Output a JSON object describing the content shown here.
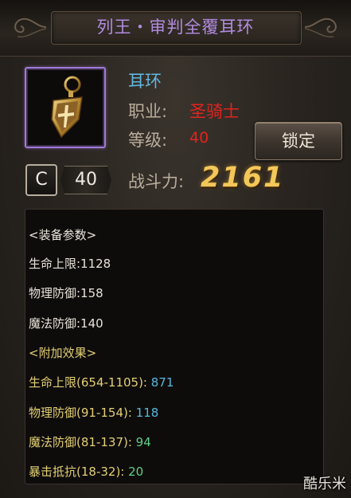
{
  "window": {
    "title": "列王・审判全覆耳环"
  },
  "item": {
    "type": "耳环",
    "job_label": "职业:",
    "job_value": "圣骑士",
    "level_label": "等级:",
    "level_value": "40",
    "icon": "shield-earring-icon",
    "rarity_color": "#a07ad8"
  },
  "buttons": {
    "lock_label": "锁定"
  },
  "grade": {
    "letter": "C",
    "value": "40"
  },
  "power": {
    "label": "战斗力:",
    "value": "2161"
  },
  "stats": {
    "base_header": "<装备参数>",
    "base": [
      {
        "text": "生命上限:1128"
      },
      {
        "text": "物理防御:158"
      },
      {
        "text": "魔法防御:140"
      }
    ],
    "bonus_header": "<附加效果>",
    "bonus": [
      {
        "label": "生命上限(654-1105):",
        "value": "871",
        "color": "blue"
      },
      {
        "label": "物理防御(91-154):",
        "value": "118",
        "color": "blue"
      },
      {
        "label": "魔法防御(81-137):",
        "value": "94",
        "color": "green"
      },
      {
        "label": "暴击抵抗(18-32):",
        "value": "20",
        "color": "green"
      }
    ]
  },
  "watermark": "酷乐米"
}
